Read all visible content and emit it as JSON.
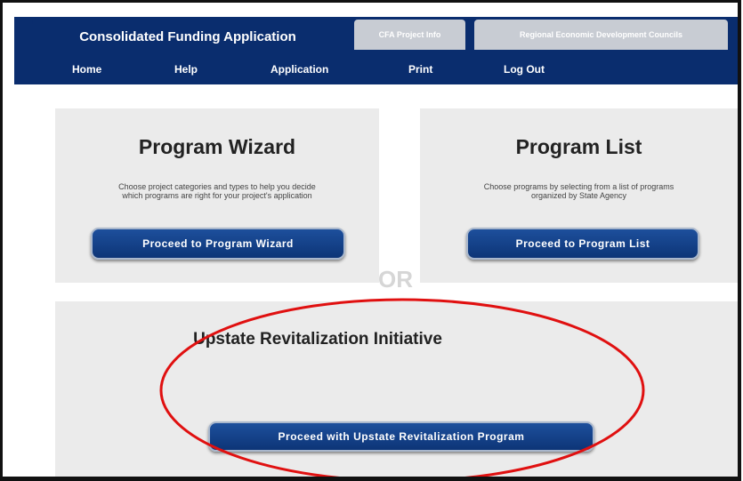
{
  "tabs": {
    "main": "Consolidated Funding Application",
    "cfa_project_info": "CFA Project Info",
    "regional_councils": "Regional Economic Development Councils"
  },
  "nav": [
    "Home",
    "Help",
    "Application",
    "Print",
    "Log Out"
  ],
  "program_wizard": {
    "title": "Program Wizard",
    "description_line1": "Choose project categories and types to help you decide",
    "description_line2": "which programs are right for your project's application",
    "button": "Proceed to Program Wizard"
  },
  "program_list": {
    "title": "Program List",
    "description_line1": "Choose programs by selecting from a list of programs",
    "description_line2": "organized by State Agency",
    "button": "Proceed to Program List"
  },
  "or_label": "OR",
  "upstate": {
    "title": "Upstate Revitalization Initiative",
    "button": "Proceed with Upstate Revitalization Program"
  },
  "annotation_color": "#e01010"
}
